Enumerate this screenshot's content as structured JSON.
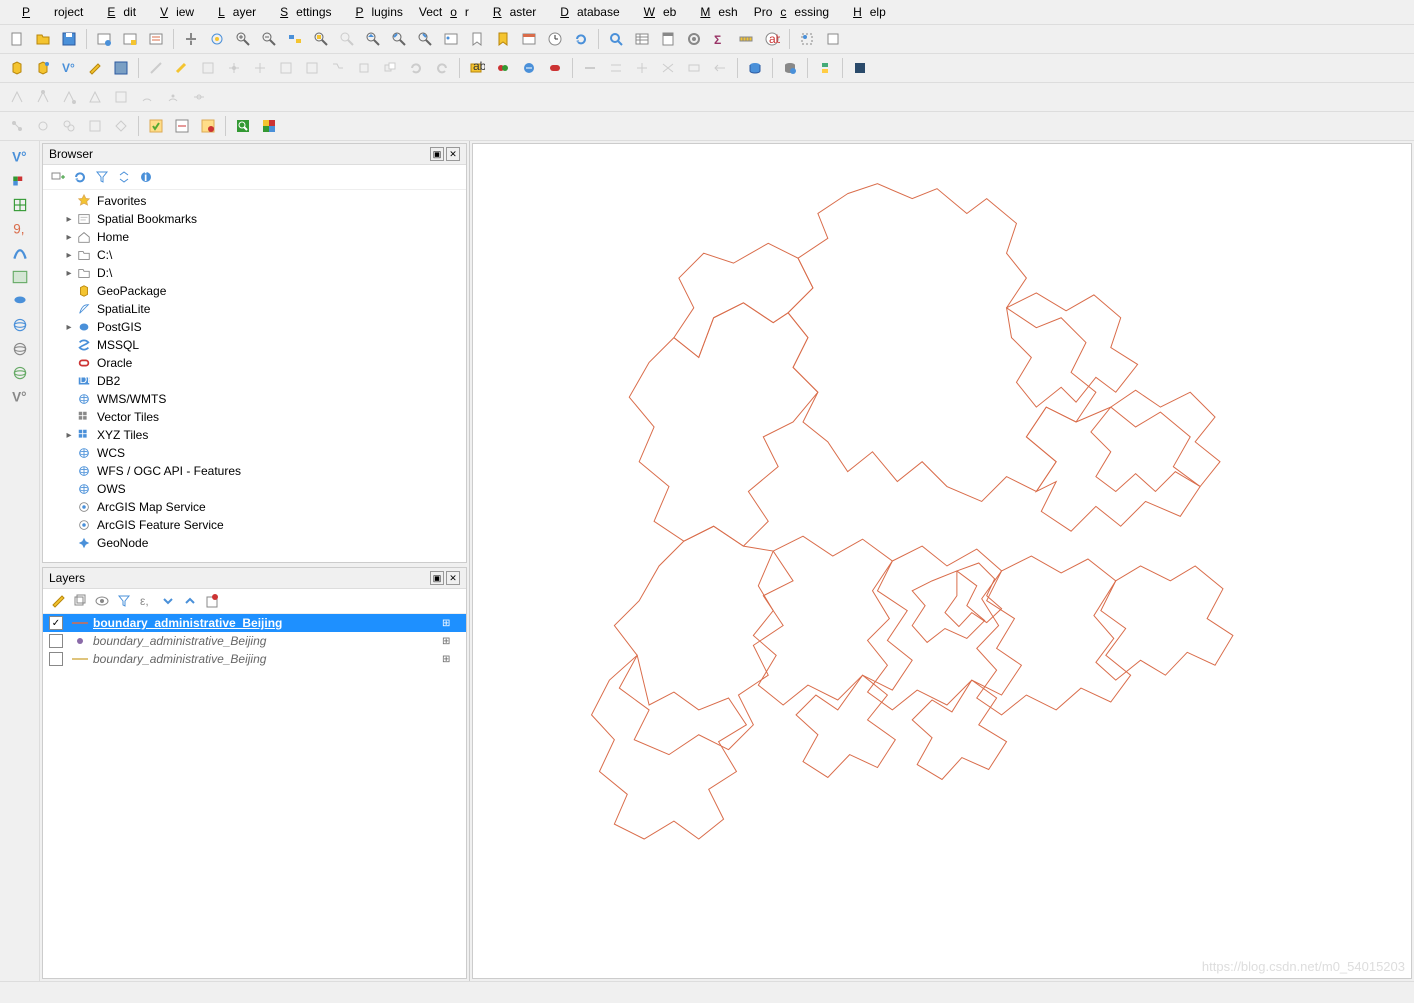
{
  "menu": [
    "Project",
    "Edit",
    "View",
    "Layer",
    "Settings",
    "Plugins",
    "Vector",
    "Raster",
    "Database",
    "Web",
    "Mesh",
    "Processing",
    "Help"
  ],
  "browser": {
    "title": "Browser",
    "items": [
      {
        "expand": "",
        "icon": "star",
        "label": "Favorites"
      },
      {
        "expand": "▸",
        "icon": "bookmark",
        "label": "Spatial Bookmarks"
      },
      {
        "expand": "▸",
        "icon": "home",
        "label": "Home"
      },
      {
        "expand": "▸",
        "icon": "folder",
        "label": "C:\\"
      },
      {
        "expand": "▸",
        "icon": "folder",
        "label": "D:\\"
      },
      {
        "expand": "",
        "icon": "geopkg",
        "label": "GeoPackage"
      },
      {
        "expand": "",
        "icon": "feather",
        "label": "SpatiaLite"
      },
      {
        "expand": "▸",
        "icon": "elephant",
        "label": "PostGIS"
      },
      {
        "expand": "",
        "icon": "mssql",
        "label": "MSSQL"
      },
      {
        "expand": "",
        "icon": "oracle",
        "label": "Oracle"
      },
      {
        "expand": "",
        "icon": "db2",
        "label": "DB2"
      },
      {
        "expand": "",
        "icon": "globe",
        "label": "WMS/WMTS"
      },
      {
        "expand": "",
        "icon": "grid",
        "label": "Vector Tiles"
      },
      {
        "expand": "▸",
        "icon": "xyz",
        "label": "XYZ Tiles"
      },
      {
        "expand": "",
        "icon": "globe",
        "label": "WCS"
      },
      {
        "expand": "",
        "icon": "globe",
        "label": "WFS / OGC API - Features"
      },
      {
        "expand": "",
        "icon": "globe",
        "label": "OWS"
      },
      {
        "expand": "",
        "icon": "arcgis",
        "label": "ArcGIS Map Service"
      },
      {
        "expand": "",
        "icon": "arcgis",
        "label": "ArcGIS Feature Service"
      },
      {
        "expand": "",
        "icon": "geonode",
        "label": "GeoNode"
      }
    ]
  },
  "layers": {
    "title": "Layers",
    "rows": [
      {
        "checked": true,
        "name": "boundary_administrative_Beijing",
        "sym": "line-orange",
        "selected": true,
        "italic": false
      },
      {
        "checked": false,
        "name": "boundary_administrative_Beijing",
        "sym": "dot-purple",
        "selected": false,
        "italic": true
      },
      {
        "checked": false,
        "name": "boundary_administrative_Beijing",
        "sym": "line-yellow",
        "selected": false,
        "italic": true
      }
    ]
  },
  "watermark": "https://blog.csdn.net/m0_54015203",
  "colors": {
    "selection": "#1e90ff",
    "mapStroke": "#d96c4a"
  }
}
